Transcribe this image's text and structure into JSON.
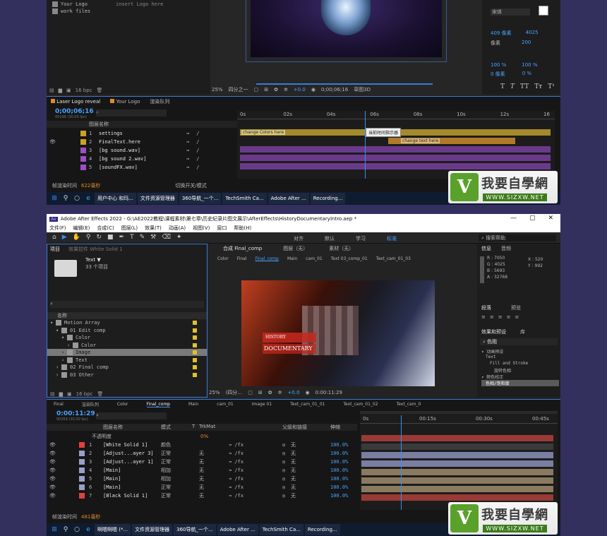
{
  "s1": {
    "proj_rows": [
      "Your Logo",
      "work files"
    ],
    "proj_note": "insert Logo here",
    "font_name": "宋体",
    "font_vals": [
      "409 像素",
      "4025",
      "像素",
      "200",
      "100 %",
      "100 %",
      "0 像素",
      "0 %"
    ],
    "preview_zoom": "25%",
    "preview_res": "四分之一",
    "preview_time": "0;00;06;16",
    "preview_val": "+0.0",
    "preview_draft": "草图3D",
    "tabs": [
      "Laser Logo reveal",
      "Your Logo",
      "渲染队列"
    ],
    "timecode": "0;00;06;16",
    "timecode_sub": "00196 (30.00 fps)",
    "layer_header": "图层名称",
    "layers": [
      {
        "num": "1",
        "name": "settings",
        "color": "#c9a227"
      },
      {
        "num": "2",
        "name": "FinalText.here",
        "color": "#c9a227"
      },
      {
        "num": "3",
        "name": "[bg sound.wav]",
        "color": "#9b4fc6"
      },
      {
        "num": "4",
        "name": "[bg sound 2.wav]",
        "color": "#9b4fc6"
      },
      {
        "num": "5",
        "name": "[soundFX.wav]",
        "color": "#9b4fc6"
      }
    ],
    "ruler": [
      "0s",
      "02s",
      "04s",
      "06s",
      "08s",
      "10s",
      "12s",
      "16"
    ],
    "marker1": "change Colors here",
    "marker2": "change text here",
    "tooltip": "当前时间指示器",
    "status_render": "帧渲染时间",
    "status_ms": "622毫秒",
    "status_toggle": "切换开关/模式"
  },
  "taskbar1": [
    "用户中心 和玛...",
    "文件资源管理器",
    "360导航_一个...",
    "TechSmith Ca...",
    "Adobe After ...",
    "Recording..."
  ],
  "taskbar2": [
    "啊嗯啊嗯 (*...",
    "文件资源管理器",
    "360导航_一个...",
    "Adobe After ...",
    "TechSmith Ca...",
    "Recording..."
  ],
  "s2": {
    "title": "Adobe After Effects 2022 - G:\\AE2022教程\\课程素材\\第七章\\历史纪录片图文展示\\AfterEffects\\HistoryDocumentaryIntro.aep *",
    "menu": [
      "文件(F)",
      "编辑(E)",
      "合成(C)",
      "图层(L)",
      "效果(T)",
      "动画(A)",
      "视图(V)",
      "窗口",
      "帮助(H)"
    ],
    "toolbar_right": [
      "对齐",
      "默认",
      "学习",
      "标准"
    ],
    "search_help": "搜索帮助",
    "project_tab": "项目",
    "effect_tab": "效果控件 White Solid 1",
    "folder_name": "Text ▼",
    "folder_count": "33 个项目",
    "col_name": "名称",
    "tree": [
      "Motion Array",
      "01 Edit comp",
      "Color",
      "Color",
      "Image",
      "Text",
      "02 Final comp",
      "03 Other"
    ],
    "comp_tab": "合成 Final_comp",
    "layer_tab": "图层（无）",
    "footage_tab": "素材（无）",
    "crumbs": [
      "Color",
      "Final",
      "Final_comp",
      "Main",
      "cam_01",
      "Text 03_comp_01",
      "Text_cam_01_03"
    ],
    "video_t1": "HISTORY",
    "video_t2": "DOCUMENTARY",
    "info_tabs": [
      "信息",
      "音频"
    ],
    "info_vals": [
      "R : 7050",
      "G : 4025",
      "B : 5693",
      "A : 32768"
    ],
    "info_xy": [
      "X : 520",
      "Y : 992"
    ],
    "para_tabs": [
      "段落",
      "预览"
    ],
    "fx_tabs": [
      "效果和预设",
      "库"
    ],
    "fx_search": "色阻",
    "fx_tree": [
      "动画预设",
      "Text",
      "Fill and Stroke",
      "旋转色相",
      "颜色校正",
      "色相/饱和度"
    ],
    "preview_zoom": "25%",
    "preview_res": "(四分…",
    "preview_val": "+0.0",
    "preview_time": "0:00:11:29",
    "tl_tabs": [
      "Final",
      "渲染队列",
      "Color",
      "Final_comp",
      "Main",
      "cam_01",
      "Image 01",
      "Text_cam_01_01",
      "Text_cam_01_02",
      "Text_cam_0"
    ],
    "timecode": "0:00:11:29",
    "timecode_sub": "00359 (30.00 fps)",
    "cols": [
      "图层名称",
      "模式",
      "T",
      "TrkMat",
      "父级和链接",
      "伸缩"
    ],
    "sub_row": "不透明度",
    "sub_val": "0%",
    "layers": [
      {
        "num": "1",
        "name": "[White Solid 1]",
        "mode": "颜色",
        "trk": "",
        "parent": "无",
        "stretch": "100.0%",
        "color": "#e04040"
      },
      {
        "num": "2",
        "name": "[Adjust...ayer 3]",
        "mode": "正常",
        "trk": "无",
        "parent": "无",
        "stretch": "100.0%",
        "color": "#9aa0c8"
      },
      {
        "num": "3",
        "name": "[Adjust...ayer 1]",
        "mode": "正常",
        "trk": "无",
        "parent": "无",
        "stretch": "100.0%",
        "color": "#9aa0c8"
      },
      {
        "num": "4",
        "name": "[Main]",
        "mode": "相加",
        "trk": "无",
        "parent": "无",
        "stretch": "100.0%",
        "color": "#9aa0c8"
      },
      {
        "num": "5",
        "name": "[Main]",
        "mode": "相加",
        "trk": "无",
        "parent": "无",
        "stretch": "100.0%",
        "color": "#9aa0c8"
      },
      {
        "num": "6",
        "name": "[Main]",
        "mode": "正常",
        "trk": "无",
        "parent": "无",
        "stretch": "100.0%",
        "color": "#9aa0c8"
      },
      {
        "num": "7",
        "name": "[Black Solid 1]",
        "mode": "正常",
        "trk": "无",
        "parent": "无",
        "stretch": "100.0%",
        "color": "#e04040"
      }
    ],
    "ruler": [
      "0s",
      "00:15s",
      "00:30s",
      "00:45s"
    ],
    "status_render": "帧渲染时间",
    "status_ms": "481毫秒"
  },
  "logo_text": "我要自學網",
  "logo_url": "WWW.SIZXW.NET"
}
